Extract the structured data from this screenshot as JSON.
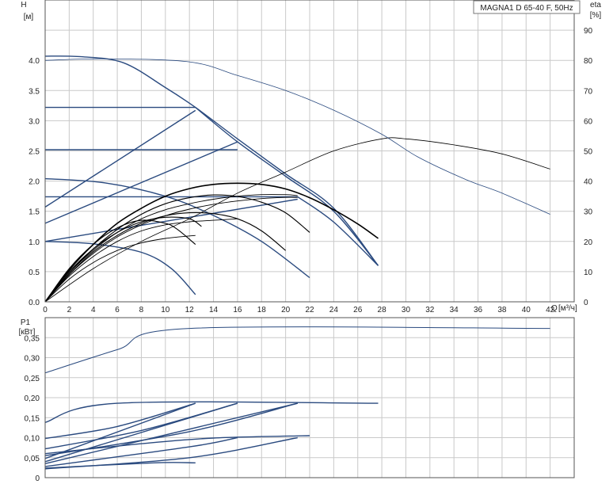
{
  "chart_data": [
    {
      "type": "line",
      "title": "MAGNA1 D 65-40 F, 50Hz",
      "ylabel": "H",
      "yunit": "[м]",
      "y2label": "eta",
      "y2unit": "[%]",
      "xlabel": "Q",
      "xunit": "[м³/ч]",
      "xlim": [
        0,
        44
      ],
      "ylim": [
        0,
        5.0
      ],
      "y2lim": [
        0,
        100
      ],
      "grid": true,
      "x_ticks": [
        "0",
        "2",
        "4",
        "6",
        "8",
        "10",
        "12",
        "14",
        "16",
        "18",
        "20",
        "22",
        "24",
        "26",
        "28",
        "30",
        "32",
        "34",
        "36",
        "38",
        "40",
        "42"
      ],
      "y_ticks": [
        "0.0",
        "0.5",
        "1.0",
        "1.5",
        "2.0",
        "2.5",
        "3.0",
        "3.5",
        "4.0"
      ],
      "y2_ticks": [
        "0",
        "10",
        "20",
        "30",
        "40",
        "50",
        "60",
        "70",
        "80",
        "90"
      ],
      "series": [
        {
          "kind": "max",
          "axis": "left",
          "color": "#2a4a7f",
          "width": 1.4,
          "points": [
            [
              0,
              4.07
            ],
            [
              3,
              4.06
            ],
            [
              6.5,
              3.96
            ],
            [
              10,
              3.55
            ],
            [
              12.5,
              3.22
            ],
            [
              16,
              2.7
            ],
            [
              20,
              2.12
            ],
            [
              24,
              1.55
            ],
            [
              27.7,
              0.6
            ]
          ]
        },
        {
          "kind": "max",
          "axis": "left",
          "color": "#2a4a7f",
          "width": 1.4,
          "points": [
            [
              0,
              2.04
            ],
            [
              5,
              1.97
            ],
            [
              10,
              1.75
            ],
            [
              14,
              1.43
            ],
            [
              18,
              1.0
            ],
            [
              22,
              0.4
            ]
          ]
        },
        {
          "kind": "max",
          "axis": "left",
          "color": "#2a4a7f",
          "width": 1.4,
          "points": [
            [
              0,
              1.0
            ],
            [
              4,
              0.96
            ],
            [
              8,
              0.82
            ],
            [
              10.5,
              0.55
            ],
            [
              12.5,
              0.12
            ]
          ]
        },
        {
          "kind": "pp",
          "axis": "left",
          "color": "#2a4a7f",
          "width": 1.4,
          "points": [
            [
              0,
              3.22
            ],
            [
              12.5,
              3.22
            ]
          ]
        },
        {
          "kind": "pp",
          "axis": "left",
          "color": "#2a4a7f",
          "width": 1.4,
          "points": [
            [
              0,
              2.52
            ],
            [
              16,
              2.52
            ]
          ]
        },
        {
          "kind": "pp",
          "axis": "left",
          "color": "#2a4a7f",
          "width": 1.4,
          "points": [
            [
              0,
              1.74
            ],
            [
              21,
              1.74
            ]
          ]
        },
        {
          "kind": "pp",
          "axis": "left",
          "color": "#2a4a7f",
          "width": 1.4,
          "points": [
            [
              12.5,
              3.22
            ],
            [
              16,
              2.65
            ],
            [
              20,
              2.08
            ],
            [
              24,
              1.5
            ],
            [
              27.7,
              0.6
            ]
          ]
        },
        {
          "kind": "pp",
          "axis": "left",
          "color": "#2a4a7f",
          "width": 1.4,
          "points": [
            [
              21,
              1.74
            ],
            [
              24,
              1.32
            ],
            [
              27.7,
              0.6
            ]
          ]
        },
        {
          "kind": "pp",
          "axis": "left",
          "color": "#2a4a7f",
          "width": 1.4,
          "points": [
            [
              0,
              1.57
            ],
            [
              12.5,
              3.17
            ]
          ]
        },
        {
          "kind": "pp",
          "axis": "left",
          "color": "#2a4a7f",
          "width": 1.4,
          "points": [
            [
              0,
              1.3
            ],
            [
              16,
              2.65
            ]
          ]
        },
        {
          "kind": "pp",
          "axis": "left",
          "color": "#2a4a7f",
          "width": 1.4,
          "points": [
            [
              0,
              1.0
            ],
            [
              21,
              1.7
            ]
          ]
        },
        {
          "kind": "eff",
          "axis": "right",
          "color": "#000000",
          "width": 0.8,
          "points": [
            [
              0,
              0
            ],
            [
              4,
              11
            ],
            [
              8,
              20
            ],
            [
              12,
              27.5
            ],
            [
              16,
              36
            ],
            [
              20,
              43
            ],
            [
              24,
              50
            ],
            [
              28,
              54
            ],
            [
              30,
              54
            ],
            [
              34,
              52
            ],
            [
              38,
              49
            ],
            [
              42,
              44
            ]
          ]
        },
        {
          "kind": "eff",
          "axis": "right",
          "color": "#000000",
          "width": 1.6,
          "points": [
            [
              0,
              0
            ],
            [
              2,
              10.5
            ],
            [
              4,
              19
            ],
            [
              6,
              26
            ],
            [
              8,
              31
            ],
            [
              10,
              35
            ],
            [
              12,
              37.5
            ],
            [
              14,
              38.9
            ],
            [
              16,
              39.3
            ],
            [
              18,
              38.9
            ],
            [
              20,
              37.4
            ],
            [
              22,
              34.5
            ],
            [
              24,
              30.5
            ],
            [
              26,
              25.8
            ],
            [
              27.7,
              21
            ]
          ]
        },
        {
          "kind": "eff",
          "axis": "right",
          "color": "#000000",
          "width": 1.1,
          "points": [
            [
              0,
              0
            ],
            [
              2,
              9.5
            ],
            [
              4,
              17.5
            ],
            [
              6,
              24
            ],
            [
              8,
              29
            ],
            [
              10,
              32.5
            ],
            [
              12,
              34.5
            ],
            [
              14,
              35.4
            ],
            [
              16,
              34.9
            ],
            [
              18,
              33
            ],
            [
              20,
              29.5
            ],
            [
              22,
              23
            ]
          ]
        },
        {
          "kind": "eff",
          "axis": "right",
          "color": "#000000",
          "width": 1.1,
          "points": [
            [
              0,
              0
            ],
            [
              2,
              9
            ],
            [
              4,
              16.5
            ],
            [
              6,
              22
            ],
            [
              8,
              26
            ],
            [
              10,
              28.5
            ],
            [
              12,
              29.5
            ],
            [
              14,
              29.2
            ],
            [
              16,
              27.5
            ],
            [
              18,
              23.5
            ],
            [
              20,
              17
            ]
          ]
        },
        {
          "kind": "eff",
          "axis": "right",
          "color": "#000000",
          "width": 1.1,
          "points": [
            [
              0,
              0
            ],
            [
              2,
              10
            ],
            [
              4,
              17.5
            ],
            [
              6,
              23
            ],
            [
              8,
              26.5
            ],
            [
              10,
              28
            ],
            [
              12,
              27.5
            ],
            [
              13,
              25
            ]
          ]
        },
        {
          "kind": "eff",
          "axis": "right",
          "color": "#000000",
          "width": 1.1,
          "points": [
            [
              0,
              0
            ],
            [
              2,
              11
            ],
            [
              4,
              19
            ],
            [
              6,
              24.5
            ],
            [
              8,
              27
            ],
            [
              10,
              26
            ],
            [
              11,
              24
            ],
            [
              12.5,
              19
            ]
          ]
        },
        {
          "kind": "eff",
          "axis": "right",
          "color": "#000000",
          "width": 0.9,
          "points": [
            [
              0,
              0
            ],
            [
              2,
              9.5
            ],
            [
              4,
              17
            ],
            [
              6,
              23
            ],
            [
              8,
              27.5
            ],
            [
              10,
              30.5
            ],
            [
              12,
              32.5
            ],
            [
              14,
              34
            ],
            [
              16,
              35
            ],
            [
              18,
              35.5
            ],
            [
              20,
              35.5
            ],
            [
              21,
              35.2
            ]
          ]
        },
        {
          "kind": "eff",
          "axis": "right",
          "color": "#000000",
          "width": 0.9,
          "points": [
            [
              0,
              0
            ],
            [
              2,
              9
            ],
            [
              4,
              16
            ],
            [
              6,
              21.5
            ],
            [
              8,
              25.5
            ],
            [
              10,
              28.5
            ],
            [
              12,
              30.7
            ],
            [
              14,
              32.3
            ],
            [
              16,
              33.4
            ],
            [
              18,
              34.2
            ],
            [
              20,
              34.6
            ],
            [
              21,
              34.6
            ]
          ]
        },
        {
          "kind": "eff",
          "axis": "right",
          "color": "#000000",
          "width": 0.9,
          "points": [
            [
              0,
              0
            ],
            [
              2,
              8.5
            ],
            [
              4,
              15
            ],
            [
              6,
              20
            ],
            [
              8,
              23.5
            ],
            [
              10,
              25.5
            ],
            [
              12,
              26.5
            ],
            [
              14,
              27
            ],
            [
              16,
              27.5
            ]
          ]
        },
        {
          "kind": "eff",
          "axis": "right",
          "color": "#000000",
          "width": 0.9,
          "points": [
            [
              0,
              0
            ],
            [
              2,
              7.5
            ],
            [
              4,
              13
            ],
            [
              6,
              17
            ],
            [
              8,
              19.5
            ],
            [
              10,
              21
            ],
            [
              12.5,
              22
            ]
          ]
        },
        {
          "kind": "eff2",
          "axis": "right",
          "color": "#2a4a7f",
          "width": 0.8,
          "points": [
            [
              0,
              80
            ],
            [
              5,
              80.5
            ],
            [
              12,
              79.5
            ],
            [
              16,
              75
            ],
            [
              20,
              70
            ],
            [
              24,
              63.5
            ],
            [
              28,
              55.5
            ],
            [
              31,
              48
            ],
            [
              35,
              40.5
            ],
            [
              38,
              36
            ],
            [
              42,
              29
            ]
          ]
        }
      ]
    },
    {
      "type": "line",
      "ylabel": "P1",
      "yunit": "[кВт]",
      "xlim": [
        0,
        44
      ],
      "ylim": [
        0,
        0.4
      ],
      "grid": true,
      "y_ticks": [
        "0",
        "0,05",
        "0,10",
        "0,15",
        "0,20",
        "0,25",
        "0,30",
        "0,35"
      ],
      "series": [
        {
          "color": "#2a4a7f",
          "width": 1.0,
          "points": [
            [
              0,
              0.262
            ],
            [
              6,
              0.32
            ],
            [
              12,
              0.373
            ],
            [
              42,
              0.373
            ]
          ]
        },
        {
          "color": "#2a4a7f",
          "width": 1.4,
          "points": [
            [
              0,
              0.138
            ],
            [
              6,
              0.186
            ],
            [
              27.7,
              0.186
            ]
          ]
        },
        {
          "color": "#2a4a7f",
          "width": 1.4,
          "points": [
            [
              0,
              0.098
            ],
            [
              6,
              0.128
            ],
            [
              12.5,
              0.186
            ]
          ]
        },
        {
          "color": "#2a4a7f",
          "width": 1.4,
          "points": [
            [
              0,
              0.072
            ],
            [
              8,
              0.118
            ],
            [
              16,
              0.186
            ]
          ]
        },
        {
          "color": "#2a4a7f",
          "width": 1.4,
          "points": [
            [
              0,
              0.055
            ],
            [
              12,
              0.115
            ],
            [
              21,
              0.186
            ]
          ]
        },
        {
          "color": "#2a4a7f",
          "width": 1.4,
          "points": [
            [
              0,
              0.048
            ],
            [
              12.5,
              0.186
            ]
          ]
        },
        {
          "color": "#2a4a7f",
          "width": 1.4,
          "points": [
            [
              0,
              0.04
            ],
            [
              16,
              0.186
            ]
          ]
        },
        {
          "color": "#2a4a7f",
          "width": 1.4,
          "points": [
            [
              0,
              0.035
            ],
            [
              21,
              0.186
            ]
          ]
        },
        {
          "color": "#2a4a7f",
          "width": 1.4,
          "points": [
            [
              0,
              0.06
            ],
            [
              8,
              0.085
            ],
            [
              14,
              0.099
            ],
            [
              22,
              0.105
            ]
          ]
        },
        {
          "color": "#2a4a7f",
          "width": 1.4,
          "points": [
            [
              0,
              0.028
            ],
            [
              12,
              0.077
            ],
            [
              16,
              0.1
            ]
          ]
        },
        {
          "color": "#2a4a7f",
          "width": 1.4,
          "points": [
            [
              0,
              0.024
            ],
            [
              9,
              0.037
            ],
            [
              12.5,
              0.037
            ]
          ]
        },
        {
          "color": "#2a4a7f",
          "width": 1.4,
          "points": [
            [
              0,
              0.022
            ],
            [
              12,
              0.05
            ],
            [
              21,
              0.1
            ]
          ]
        }
      ]
    }
  ]
}
